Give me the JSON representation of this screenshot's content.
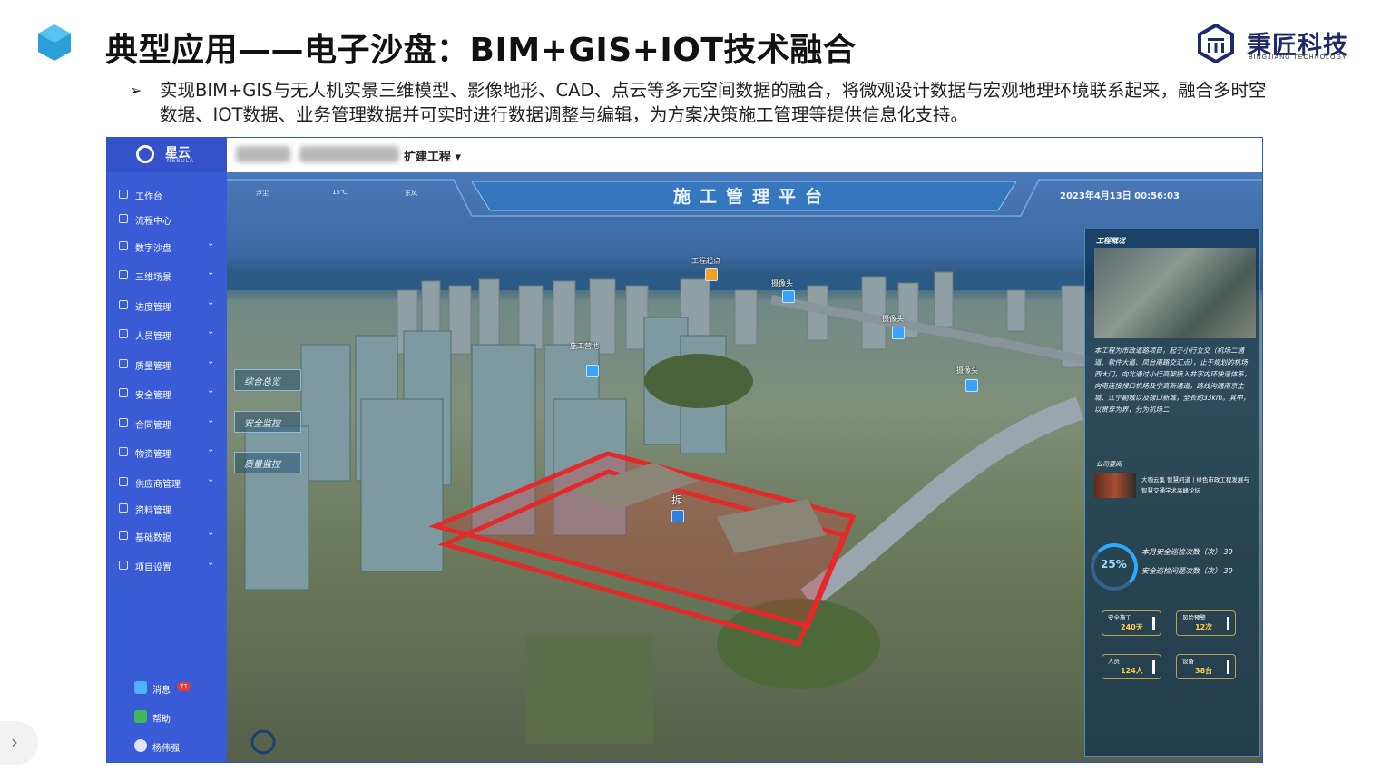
{
  "slide": {
    "title": "典型应用——电子沙盘：BIM+GIS+IOT技术融合",
    "bullet_marker": "➢",
    "description": "实现BIM+GIS与无人机实景三维模型、影像地形、CAD、点云等多元空间数据的融合，将微观设计数据与宏观地理环境联系起来，融合多时空数据、IOT数据、业务管理数据并可实时进行数据调整与编辑，为方案决策施工管理等提供信息化支持。"
  },
  "brand": {
    "name": "秉匠科技",
    "sub": "BINGJIANG TECHNOLOGY",
    "color": "#1d2b6b"
  },
  "app": {
    "logo_name": "星云",
    "logo_en": "NEBULA",
    "project_label": "扩建工程",
    "sidebar": [
      {
        "label": "工作台",
        "icon": "monitor-icon",
        "expandable": false
      },
      {
        "label": "流程中心",
        "icon": "flow-icon",
        "expandable": false
      },
      {
        "label": "数字沙盘",
        "icon": "home-icon",
        "expandable": true
      },
      {
        "label": "三维场景",
        "icon": "cube-icon",
        "expandable": true
      },
      {
        "label": "进度管理",
        "icon": "list-icon",
        "expandable": true
      },
      {
        "label": "人员管理",
        "icon": "user-icon",
        "expandable": true
      },
      {
        "label": "质量管理",
        "icon": "quality-icon",
        "expandable": true
      },
      {
        "label": "安全管理",
        "icon": "shield-icon",
        "expandable": true
      },
      {
        "label": "合同管理",
        "icon": "contract-icon",
        "expandable": true
      },
      {
        "label": "物资管理",
        "icon": "box-icon",
        "expandable": true
      },
      {
        "label": "供应商管理",
        "icon": "supplier-icon",
        "expandable": true
      },
      {
        "label": "资料管理",
        "icon": "doc-icon",
        "expandable": false
      },
      {
        "label": "基础数据",
        "icon": "database-icon",
        "expandable": true
      },
      {
        "label": "项目设置",
        "icon": "settings-icon",
        "expandable": true
      }
    ],
    "footer": {
      "messages_label": "消息",
      "messages_count": "71",
      "help_label": "帮助",
      "user_label": "杨伟强"
    },
    "scene": {
      "title": "施工管理平台",
      "weather": "浮尘",
      "temperature": "15℃",
      "wind": "东风",
      "datetime": "2023年4月13日 00:56:03",
      "left_panels": [
        "综合总览",
        "安全监控",
        "质量监控"
      ],
      "markers": [
        "工程起点",
        "施工营地",
        "摄像头",
        "摄像头",
        "摄像头"
      ],
      "site_label": "拆"
    },
    "overview_panel": {
      "title": "工程概况",
      "text": "本工程为市政道路项目，起于小行立交（机场二通道、软件大道、凤台南路交汇点），止于规划的机场西大门，向北通过小行高架接入井字内环快速体系，向南连接禄口机场及宁高新通道，路线沟通南京主城、江宁副城以及禄口新城，全长约33km。其中，以贯穿为界，分为机场二",
      "news_title": "公司要闻",
      "news_text": "大咖云集 智慧问道 | 绿色市政工程发展与智慧交通学术高峰论坛",
      "gauge_value": "25%",
      "stats": [
        {
          "label": "本月安全巡检次数（次）",
          "value": "39"
        },
        {
          "label": "安全巡检问题次数（次）",
          "value": "39"
        }
      ],
      "kpis": [
        {
          "label": "安全施工",
          "value": "240天"
        },
        {
          "label": "风险预警",
          "value": "12次"
        },
        {
          "label": "人员",
          "value": "124人"
        },
        {
          "label": "设备",
          "value": "38台"
        }
      ]
    }
  }
}
